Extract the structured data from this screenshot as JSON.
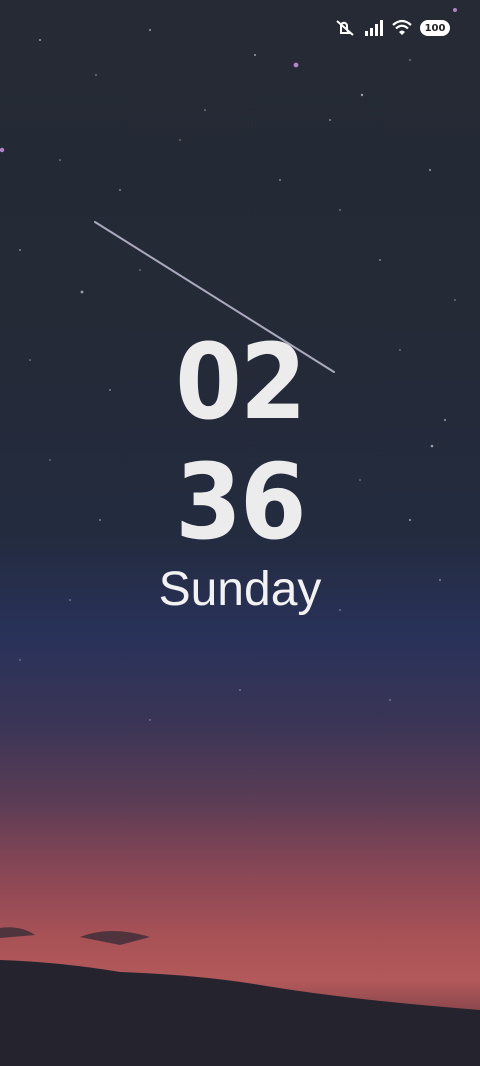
{
  "status_bar": {
    "icons": [
      "vibrate-off-icon",
      "signal-icon",
      "wifi-icon",
      "battery-icon"
    ],
    "battery_level": "100"
  },
  "lockscreen": {
    "hours": "02",
    "minutes": "36",
    "day": "Sunday"
  },
  "colors": {
    "clock_text": "#ececec",
    "sky_top": "#252a34",
    "horizon_glow": "#b3595a"
  }
}
